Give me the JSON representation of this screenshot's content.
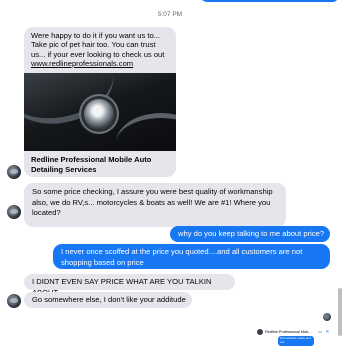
{
  "timestamp": "5:07 PM",
  "messages": {
    "card": {
      "text_line1": "Were happy to do it if you want us to...",
      "text_line2": "Take pic of pet hair too. You can trust",
      "text_line3": "us... if your ever looking to check us out",
      "link": "www.redlineprofessionals.com",
      "title_line1": "Redline Professional Mobile Auto",
      "title_line2": "Detailing Services"
    },
    "m2_line1": "So some price checking, I assure you were best quality of workmanship",
    "m2_line2": "also, we do RV,s... motorcycles & boats as well! We are #1! Where you",
    "m2_line3": "located?",
    "m3": "why do you keep talking to me about price?",
    "m4_line1": "I never once scoffed at the price you quoted....and all customers are not",
    "m4_line2": "shopping based on price",
    "m5": "I DIDNT EVEN SAY PRICE WHAT ARE YOU TALKIN ABOUT",
    "m6": "Go somewhere else, I don't like your additude"
  },
  "mini_chat": {
    "name": "Redline Professional Mob...",
    "icons": "▭ ✕",
    "bubble_line1": "Dirt vehicles inside and",
    "bubble_line2": "out"
  },
  "colors": {
    "outgoing": "#1877f2",
    "incoming": "#e4e6eb",
    "timestamp": "#65676b"
  }
}
